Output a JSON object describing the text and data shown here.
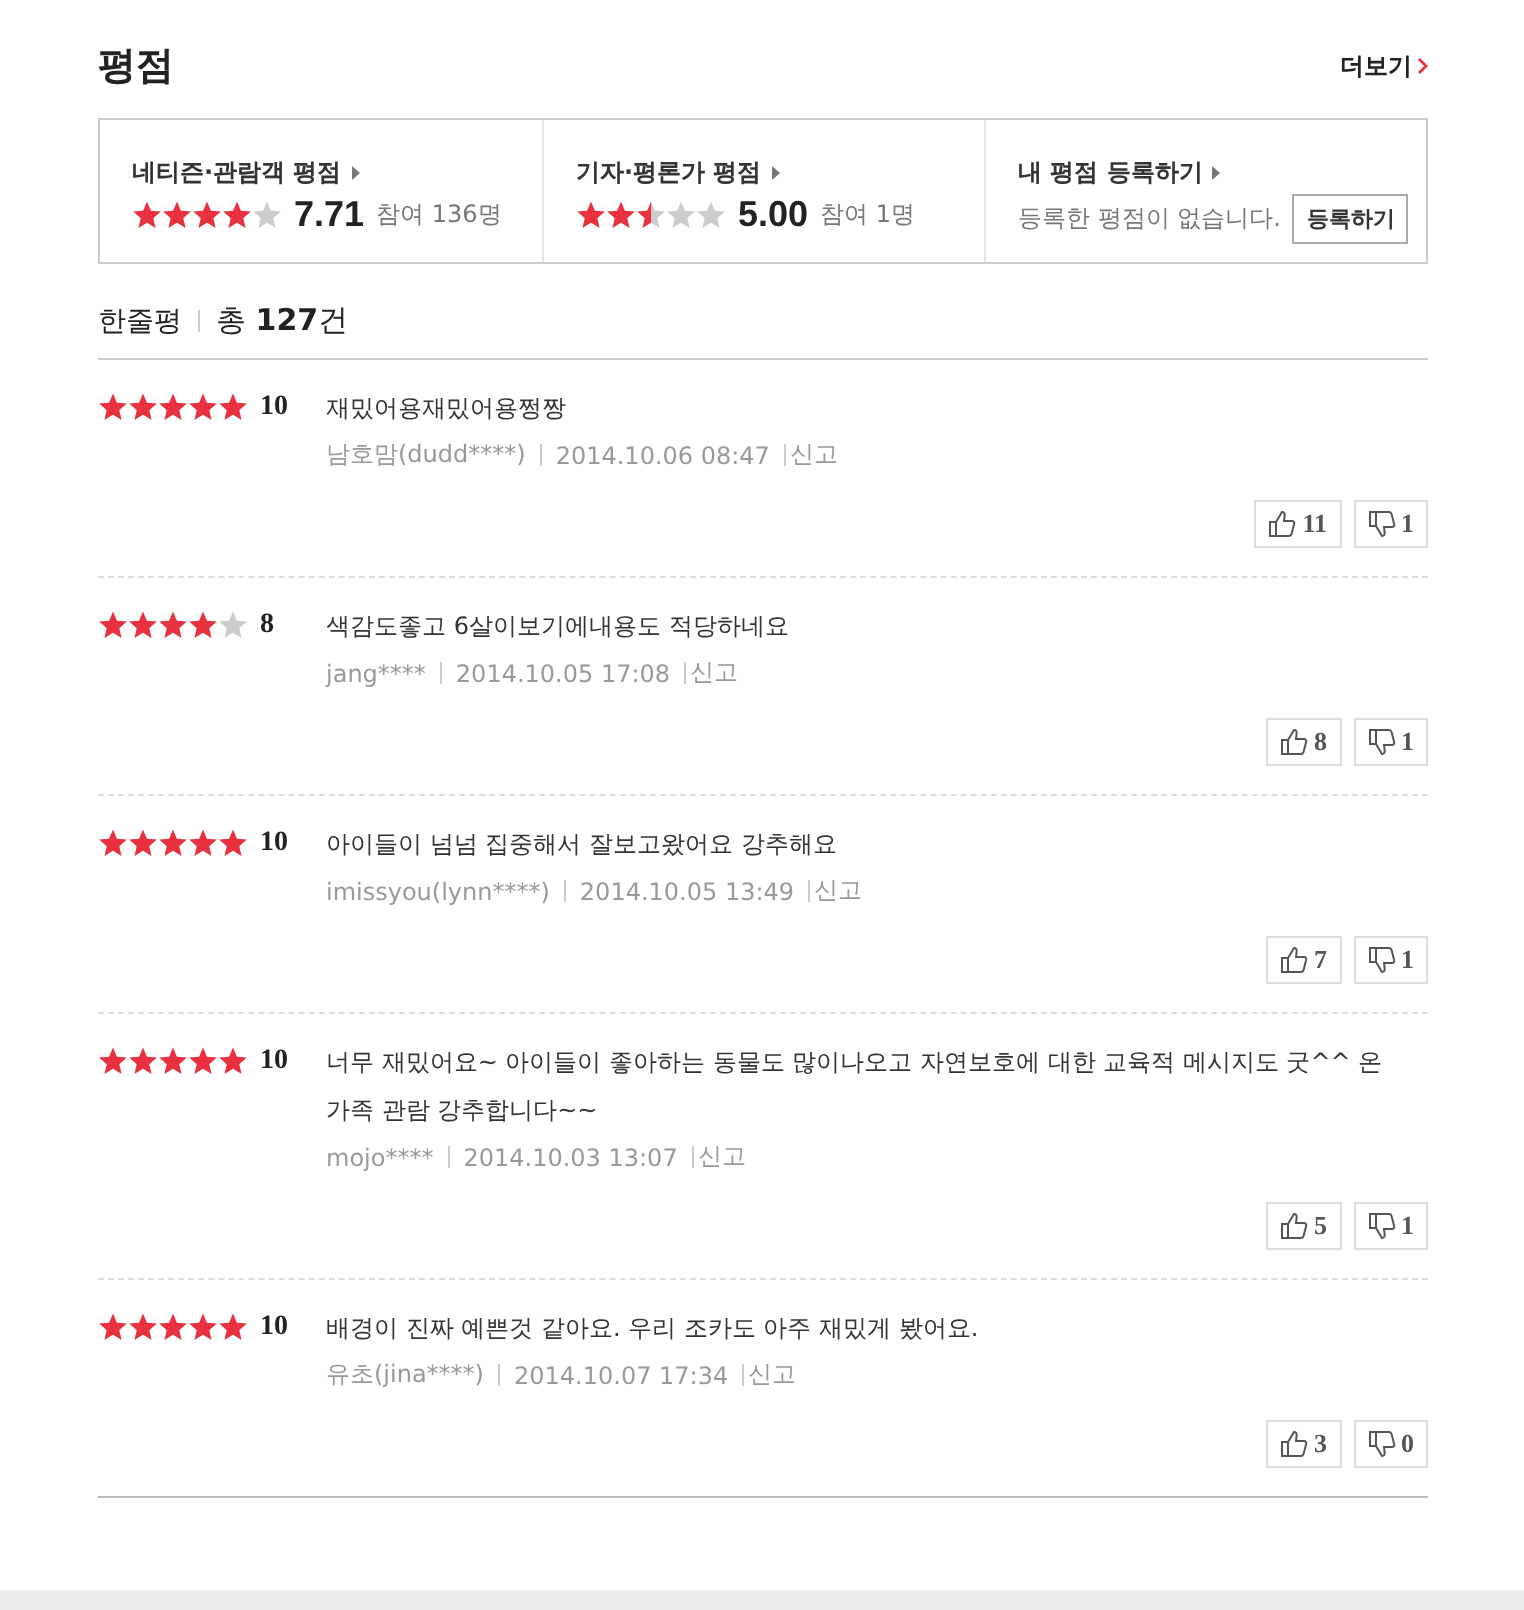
{
  "title": "평점",
  "more_link": "더보기",
  "summary": [
    {
      "kind": "rating",
      "label": "네티즌·관람객 평점",
      "stars": 4,
      "score": "7.71",
      "participants": "참여 136명"
    },
    {
      "kind": "rating",
      "label": "기자·평론가 평점",
      "stars": 2.5,
      "score": "5.00",
      "participants": "참여 1명"
    },
    {
      "kind": "register",
      "label": "내 평점 등록하기",
      "message": "등록한 평점이 없습니다.",
      "button": "등록하기"
    }
  ],
  "comments_header": {
    "label": "한줄평",
    "total_prefix": "총",
    "total": "127",
    "total_suffix": "건"
  },
  "reviews": [
    {
      "stars": 5,
      "score": "10",
      "text": "재밌어용재밌어용쩡짱",
      "author": "남호맘(dudd****)",
      "date": "2014.10.06 08:47",
      "report": "신고",
      "likes": "11",
      "dislikes": "1"
    },
    {
      "stars": 4,
      "score": "8",
      "text": "색감도좋고 6살이보기에내용도 적당하네요",
      "author": "jang****",
      "date": "2014.10.05 17:08",
      "report": "신고",
      "likes": "8",
      "dislikes": "1"
    },
    {
      "stars": 5,
      "score": "10",
      "text": "아이들이 넘넘 집중해서 잘보고왔어요 강추해요",
      "author": "imissyou(lynn****)",
      "date": "2014.10.05 13:49",
      "report": "신고",
      "likes": "7",
      "dislikes": "1"
    },
    {
      "stars": 5,
      "score": "10",
      "text": "너무 재밌어요~ 아이들이 좋아하는 동물도 많이나오고 자연보호에 대한 교육적 메시지도 굿^^ 온 가족 관람 강추합니다~~",
      "author": "mojo****",
      "date": "2014.10.03 13:07",
      "report": "신고",
      "likes": "5",
      "dislikes": "1"
    },
    {
      "stars": 5,
      "score": "10",
      "text": "배경이 진짜 예쁜것 같아요. 우리 조카도 아주 재밌게 봤어요.",
      "author": "유초(jina****)",
      "date": "2014.10.07 17:34",
      "report": "신고",
      "likes": "3",
      "dislikes": "0"
    }
  ]
}
